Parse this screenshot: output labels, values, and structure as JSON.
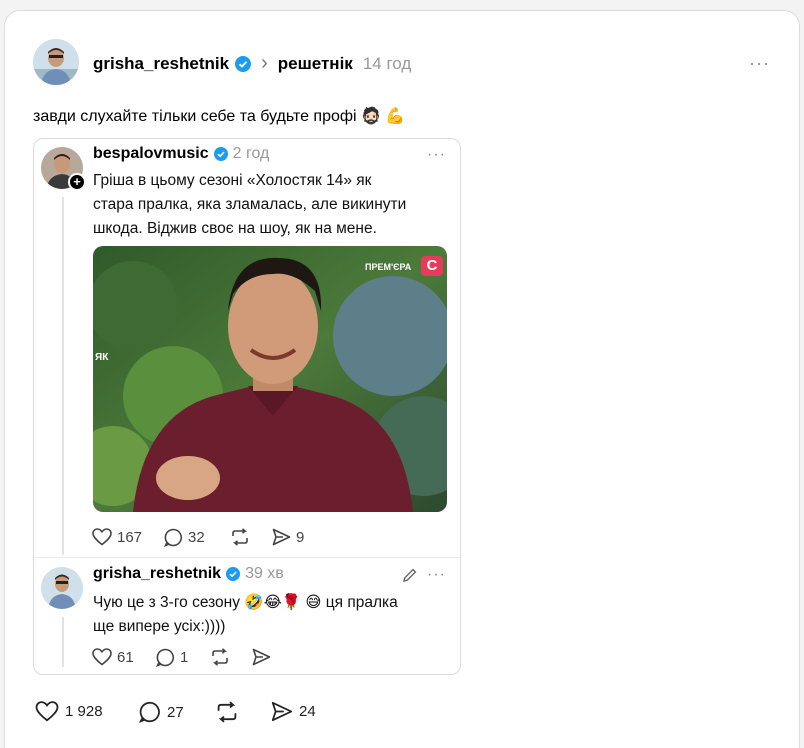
{
  "post": {
    "author": "grisha_reshetnik",
    "separator": "›",
    "topic": "решетнік",
    "time": "14 год",
    "more": "···",
    "text": "завди слухайте тільки себе та будьте профі 🧔🏻 💪",
    "actions": {
      "likes": "1 928",
      "replies": "27",
      "reposts": "",
      "shares": "24"
    }
  },
  "quoted": {
    "author": "bespalovmusic",
    "time": "2 год",
    "more": "···",
    "text_lines": [
      "Гріша в цьому сезоні «Холостяк 14» як",
      "стара пралка, яка зламалась, але викинути",
      "шкода. Віджив своє на шоу, як на мене."
    ],
    "media": {
      "channel_badge": "ПРЕМ'ЄРА",
      "watermark_left": "ЯК",
      "logo_letter": "С"
    },
    "actions": {
      "likes": "167",
      "replies": "32",
      "shares": "9"
    },
    "reply": {
      "author": "grisha_reshetnik",
      "time": "39 хв",
      "more": "···",
      "text_lines": [
        "Чую це з 3-го сезону 🤣😂🌹 😅 ця пралка",
        "ще випере усіх:))))"
      ],
      "actions": {
        "likes": "61",
        "replies": "1"
      }
    }
  },
  "colors": {
    "verified": "#1d9bf0",
    "accent_logo": "#e63b5a"
  }
}
